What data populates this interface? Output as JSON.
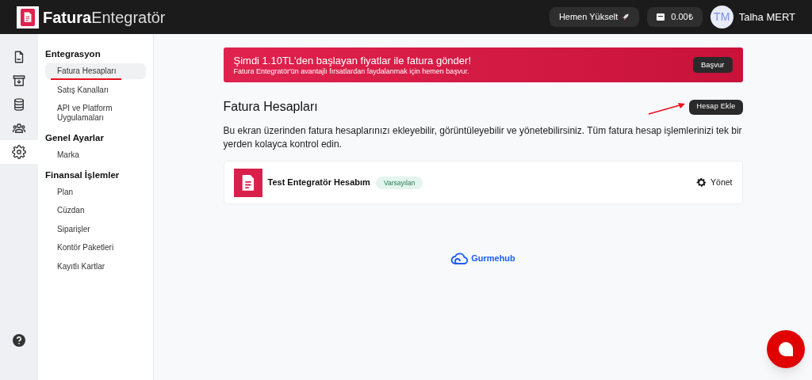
{
  "header": {
    "logo_bold": "Fatura",
    "logo_light": "Entegratör",
    "upgrade_button": "Hemen Yükselt",
    "balance": "0.00₺",
    "user": {
      "initials": "TM",
      "name": "Talha MERT"
    }
  },
  "rail": [
    {
      "kind": "document",
      "selected": false
    },
    {
      "kind": "archive",
      "selected": false
    },
    {
      "kind": "database",
      "selected": false
    },
    {
      "kind": "users",
      "selected": false
    },
    {
      "kind": "settings",
      "selected": true
    }
  ],
  "sidebar": [
    {
      "heading": "Entegrasyon",
      "items": [
        {
          "label": "Fatura Hesapları",
          "selected": true,
          "underlined": true
        },
        {
          "label": "Satış Kanalları",
          "selected": false,
          "underlined": false
        },
        {
          "label": "API ve Platform Uygulamaları",
          "selected": false,
          "underlined": false
        }
      ]
    },
    {
      "heading": "Genel Ayarlar",
      "items": [
        {
          "label": "Marka",
          "selected": false,
          "underlined": false
        }
      ]
    },
    {
      "heading": "Finansal İşlemler",
      "items": [
        {
          "label": "Plan",
          "selected": false,
          "underlined": false
        },
        {
          "label": "Cüzdan",
          "selected": false,
          "underlined": false
        },
        {
          "label": "Siparişler",
          "selected": false,
          "underlined": false
        },
        {
          "label": "Kontör Paketleri",
          "selected": false,
          "underlined": false
        },
        {
          "label": "Kayıtlı Kartlar",
          "selected": false,
          "underlined": false
        }
      ]
    }
  ],
  "banner": {
    "title": "Şimdi 1.10TL'den başlayan fiyatlar ile fatura gönder!",
    "subtitle": "Fatura Entegratör'ün avantajlı fırsatlardan faydalanmak için hemen başvur.",
    "button": "Başvur"
  },
  "page": {
    "title": "Fatura Hesapları",
    "add_button": "Hesap Ekle",
    "add_button_arrow": true,
    "description": "Bu ekran üzerinden fatura hesaplarınızı ekleyebilir, görüntüleyebilir ve yönetebilirsiniz. Tüm fatura hesap işlemlerinizi tek bir yerden kolayca kontrol edin."
  },
  "accounts": [
    {
      "name": "Test Entegratör Hesabım",
      "badge": "Varsayılan",
      "action": "Yönet"
    }
  ],
  "footer": {
    "brand": "Gurmehub"
  }
}
